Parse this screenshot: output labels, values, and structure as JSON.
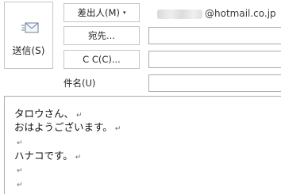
{
  "header": {
    "send_label": "送信(S)",
    "from_label": "差出人(M)",
    "from_caret": "▾",
    "from_domain": "@hotmail.co.jp",
    "to_label": "宛先...",
    "cc_label": "C C(C)...",
    "subject_label": "件名(U)",
    "to_value": "",
    "cc_value": "",
    "subject_value": ""
  },
  "body": {
    "paragraph_mark": "↵",
    "lines": [
      "タロウさん、",
      "おはようございます。",
      "",
      "ハナコです。",
      "",
      ""
    ]
  }
}
